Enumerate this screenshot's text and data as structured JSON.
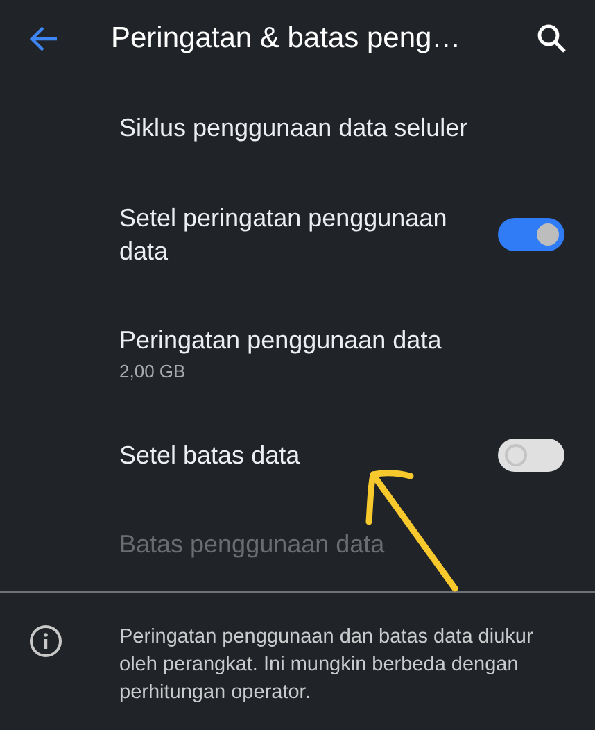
{
  "app_bar": {
    "title": "Peringatan & batas peng…"
  },
  "items": [
    {
      "kind": "plain",
      "title": "Siklus penggunaan data seluler",
      "disabled": false
    },
    {
      "kind": "toggle",
      "title": "Setel peringatan penggunaan data",
      "on": true,
      "disabled": false
    },
    {
      "kind": "value",
      "title": "Peringatan penggunaan data",
      "summary": "2,00 GB",
      "disabled": false
    },
    {
      "kind": "toggle",
      "title": "Setel batas data",
      "on": false,
      "disabled": false
    },
    {
      "kind": "plain",
      "title": "Batas penggunaan data",
      "disabled": true
    }
  ],
  "footer": {
    "text": "Peringatan penggunaan dan batas data diukur oleh perangkat. Ini mungkin berbeda dengan perhitungan operator."
  }
}
